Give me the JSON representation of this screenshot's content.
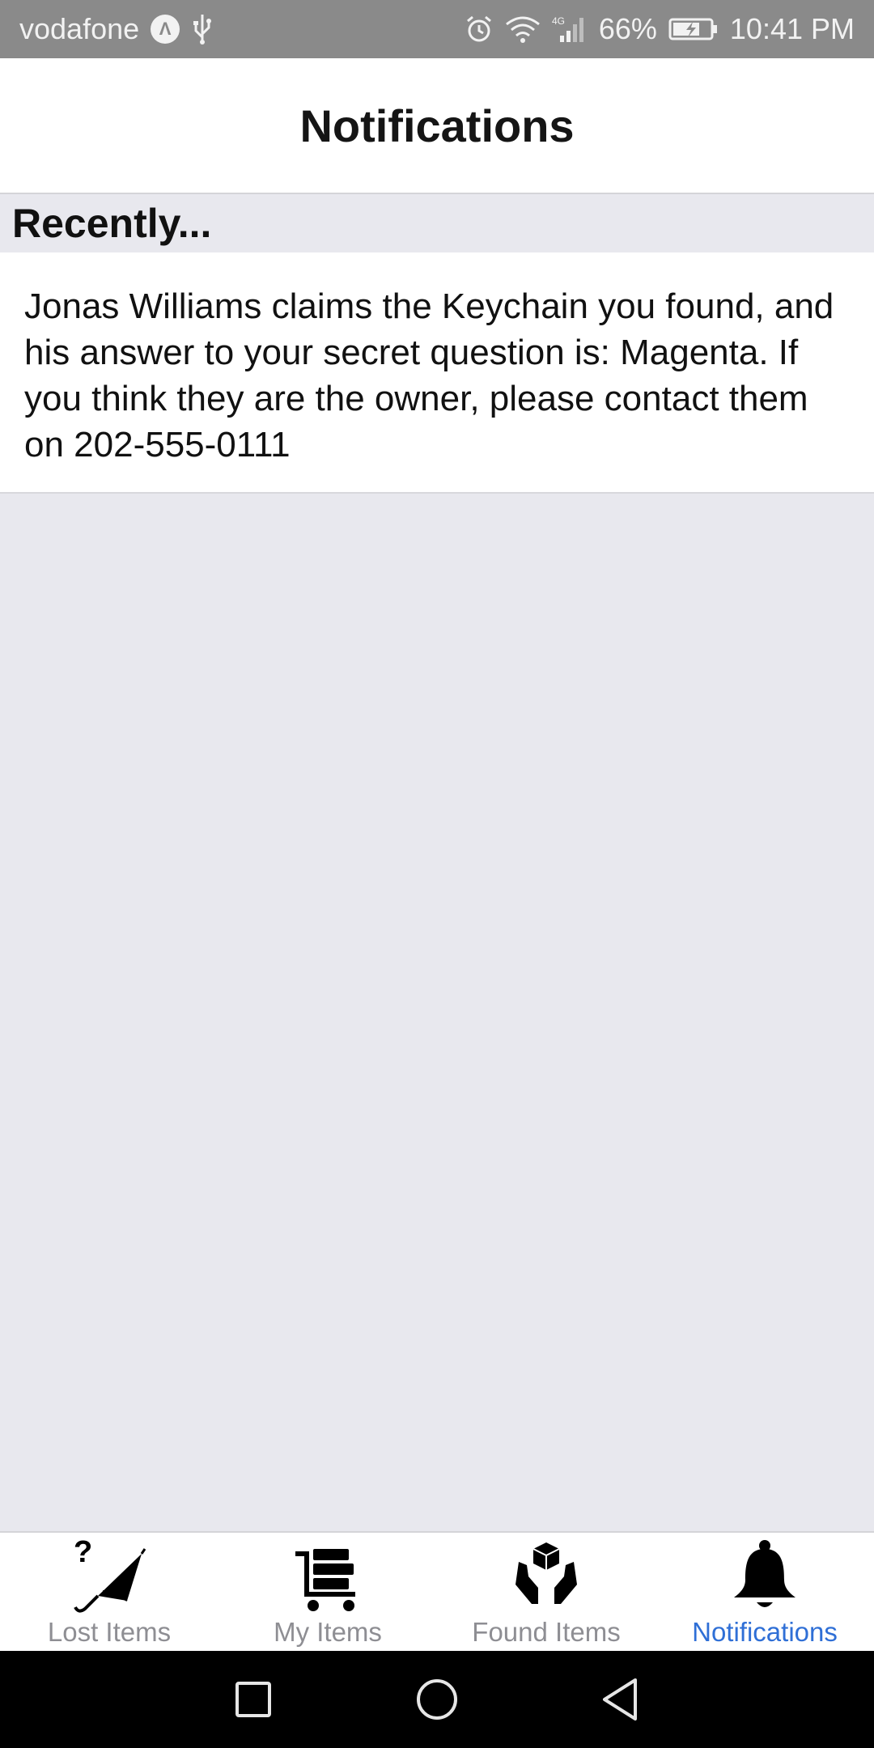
{
  "status_bar": {
    "carrier": "vodafone",
    "battery": "66%",
    "time": "10:41 PM",
    "network": "4G"
  },
  "header": {
    "title": "Notifications"
  },
  "section": {
    "title": "Recently..."
  },
  "notifications": [
    {
      "text": "Jonas Williams claims the Keychain you found, and his answer to your secret question is: Magenta. If you think they are the owner, please contact them on 202-555-0111"
    }
  ],
  "tabs": [
    {
      "label": "Lost Items",
      "icon": "lost-umbrella-icon",
      "active": false
    },
    {
      "label": "My Items",
      "icon": "cart-icon",
      "active": false
    },
    {
      "label": "Found Items",
      "icon": "hands-box-icon",
      "active": false
    },
    {
      "label": "Notifications",
      "icon": "bell-icon",
      "active": true
    }
  ],
  "nav_bar": {
    "buttons": [
      "recents-square-icon",
      "home-circle-icon",
      "back-triangle-icon"
    ]
  },
  "colors": {
    "active_tab": "#2f6fd6",
    "inactive_tab": "#8e8e93",
    "background": "#e8e8ee",
    "status_bar": "#8a8a8a"
  }
}
